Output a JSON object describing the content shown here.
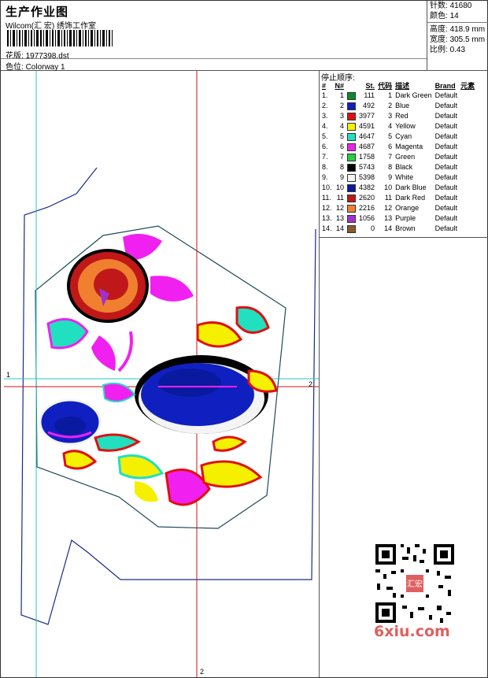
{
  "header": {
    "title": "生产作业图",
    "company": "Wilcom(汇 宏) 绣饰工作室",
    "design_label": "花版:",
    "design_file": "1977398.dst",
    "colorway_label": "色位:",
    "colorway": "Colorway 1"
  },
  "stats": {
    "stitches_label": "针数:",
    "stitches": "41680",
    "colors_label": "颜色:",
    "colors": "14",
    "height_label": "高度:",
    "height": "418.9 mm",
    "width_label": "宽度:",
    "width": "305.5 mm",
    "scale_label": "比例:",
    "scale": "0.43"
  },
  "legend": {
    "title": "停止顺序:",
    "columns": [
      "#",
      "N#",
      "St.",
      "代码",
      "描述",
      "Brand",
      "元素"
    ],
    "rows": [
      {
        "idx": "1.",
        "n": "1",
        "st": "111",
        "code": "1",
        "desc": "Dark Green",
        "brand": "Default",
        "color": "#0a8a2a"
      },
      {
        "idx": "2.",
        "n": "2",
        "st": "492",
        "code": "2",
        "desc": "Blue",
        "brand": "Default",
        "color": "#1020c0"
      },
      {
        "idx": "3.",
        "n": "3",
        "st": "3977",
        "code": "3",
        "desc": "Red",
        "brand": "Default",
        "color": "#e01010"
      },
      {
        "idx": "4.",
        "n": "4",
        "st": "4591",
        "code": "4",
        "desc": "Yellow",
        "brand": "Default",
        "color": "#f5f000"
      },
      {
        "idx": "5.",
        "n": "5",
        "st": "4647",
        "code": "5",
        "desc": "Cyan",
        "brand": "Default",
        "color": "#20e0c0"
      },
      {
        "idx": "6.",
        "n": "6",
        "st": "4687",
        "code": "6",
        "desc": "Magenta",
        "brand": "Default",
        "color": "#f020f0"
      },
      {
        "idx": "7.",
        "n": "7",
        "st": "1758",
        "code": "7",
        "desc": "Green",
        "brand": "Default",
        "color": "#20d040"
      },
      {
        "idx": "8.",
        "n": "8",
        "st": "5743",
        "code": "8",
        "desc": "Black",
        "brand": "Default",
        "color": "#000000"
      },
      {
        "idx": "9.",
        "n": "9",
        "st": "5398",
        "code": "9",
        "desc": "White",
        "brand": "Default",
        "color": "#f4f4f4"
      },
      {
        "idx": "10.",
        "n": "10",
        "st": "4382",
        "code": "10",
        "desc": "Dark Blue",
        "brand": "Default",
        "color": "#0a1aa0"
      },
      {
        "idx": "11.",
        "n": "11",
        "st": "2620",
        "code": "11",
        "desc": "Dark Red",
        "brand": "Default",
        "color": "#c01818"
      },
      {
        "idx": "12.",
        "n": "12",
        "st": "2216",
        "code": "12",
        "desc": "Orange",
        "brand": "Default",
        "color": "#f08030"
      },
      {
        "idx": "13.",
        "n": "13",
        "st": "1056",
        "code": "13",
        "desc": "Purple",
        "brand": "Default",
        "color": "#a030d0"
      },
      {
        "idx": "14.",
        "n": "14",
        "st": "0",
        "code": "14",
        "desc": "Brown",
        "brand": "Default",
        "color": "#8a5a2a"
      }
    ]
  },
  "canvas": {
    "markers": {
      "h_left": "1",
      "h_right": "2",
      "v_bottom": "2"
    }
  },
  "watermark": "6xiu.com",
  "qr_stamp_text": "汇宏",
  "colors": {
    "crosshair": "#d01010",
    "guide_cyan": "#20c8c8",
    "outline": "#1a2a8a"
  }
}
